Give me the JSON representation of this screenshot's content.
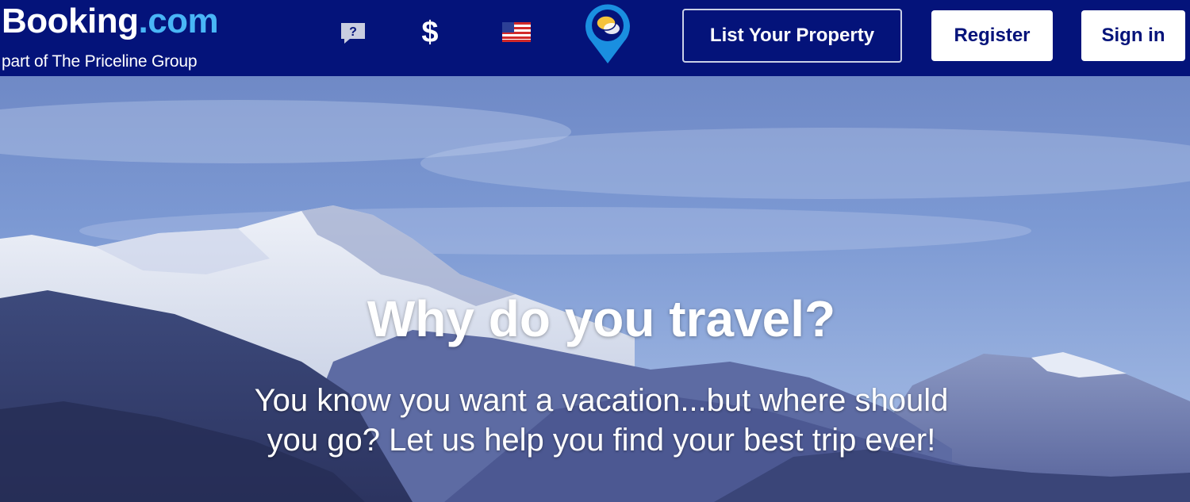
{
  "header": {
    "logo": {
      "brand": "Booking",
      "tld": ".com"
    },
    "tagline": "part of The Priceline Group",
    "icons": {
      "help": "help-question-icon",
      "currency": "$",
      "language": "us-flag-icon",
      "chat": "chat-pin-icon"
    },
    "buttons": {
      "list_property": "List Your Property",
      "register": "Register",
      "sign_in": "Sign in"
    }
  },
  "hero": {
    "title": "Why do you travel?",
    "subtitle": "You know you want a vacation...but where should you go? Let us help you find your best trip ever!"
  },
  "colors": {
    "header_bg": "#04137a",
    "logo_tld": "#49b6f6",
    "chat_pin": "#1a8fe0",
    "chat_bubble": "#f5c33b"
  }
}
